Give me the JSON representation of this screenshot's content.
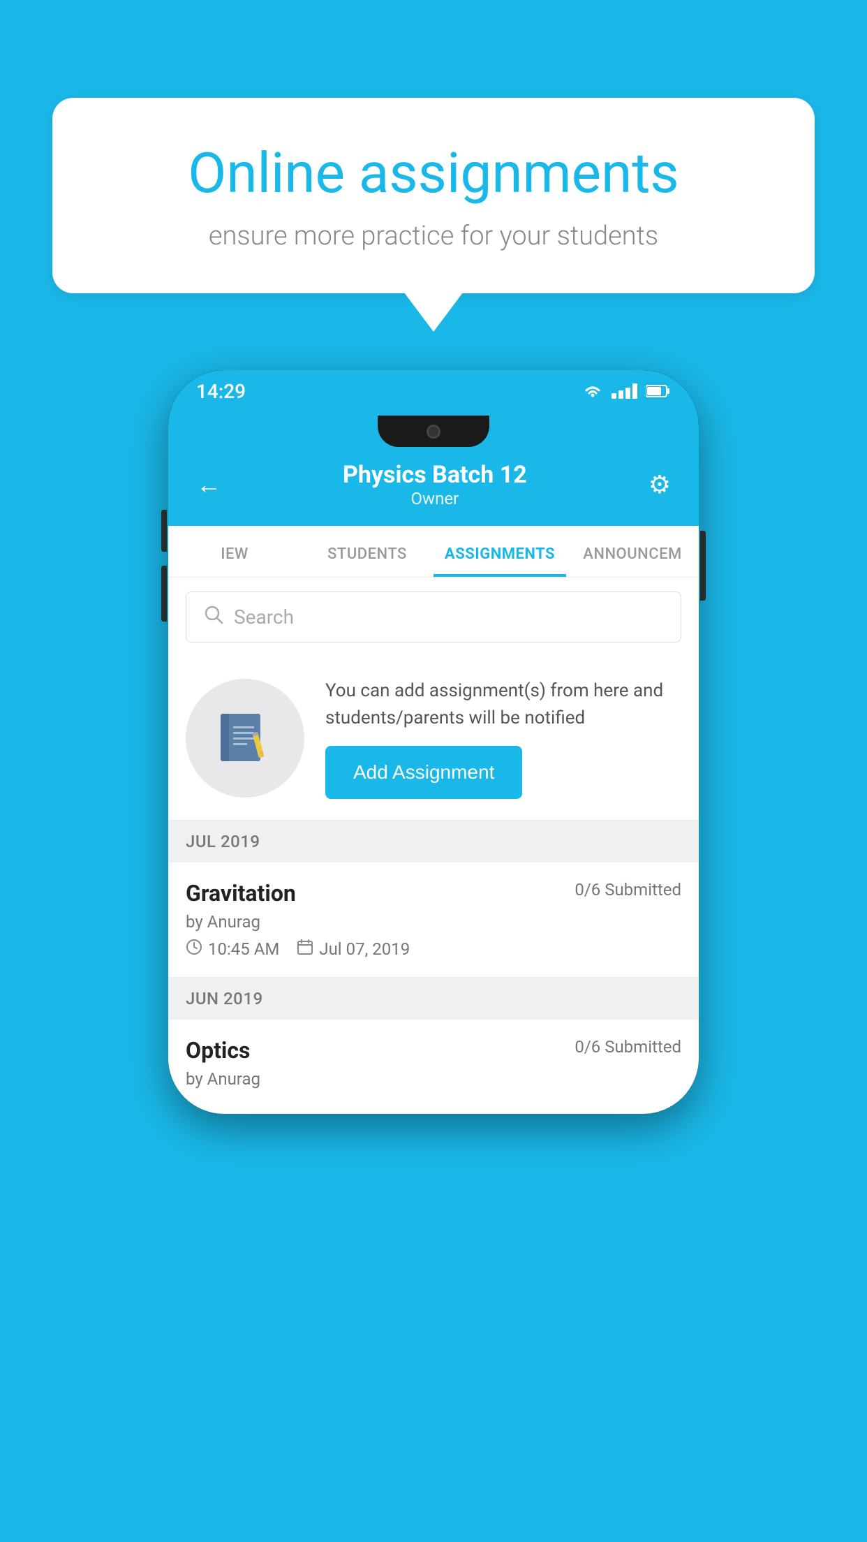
{
  "background_color": "#1ab8e8",
  "speech_bubble": {
    "title": "Online assignments",
    "subtitle": "ensure more practice for your students"
  },
  "phone": {
    "status_bar": {
      "time": "14:29"
    },
    "header": {
      "title": "Physics Batch 12",
      "subtitle": "Owner",
      "back_label": "←",
      "settings_label": "⚙"
    },
    "tabs": [
      {
        "label": "IEW",
        "active": false
      },
      {
        "label": "STUDENTS",
        "active": false
      },
      {
        "label": "ASSIGNMENTS",
        "active": true
      },
      {
        "label": "ANNOUNCEM",
        "active": false
      }
    ],
    "search": {
      "placeholder": "Search"
    },
    "add_assignment": {
      "description": "You can add assignment(s) from here and students/parents will be notified",
      "button_label": "Add Assignment"
    },
    "sections": [
      {
        "header": "JUL 2019",
        "assignments": [
          {
            "title": "Gravitation",
            "submitted": "0/6 Submitted",
            "author": "by Anurag",
            "time": "10:45 AM",
            "date": "Jul 07, 2019"
          }
        ]
      },
      {
        "header": "JUN 2019",
        "assignments": [
          {
            "title": "Optics",
            "submitted": "0/6 Submitted",
            "author": "by Anurag",
            "time": "",
            "date": ""
          }
        ]
      }
    ]
  }
}
